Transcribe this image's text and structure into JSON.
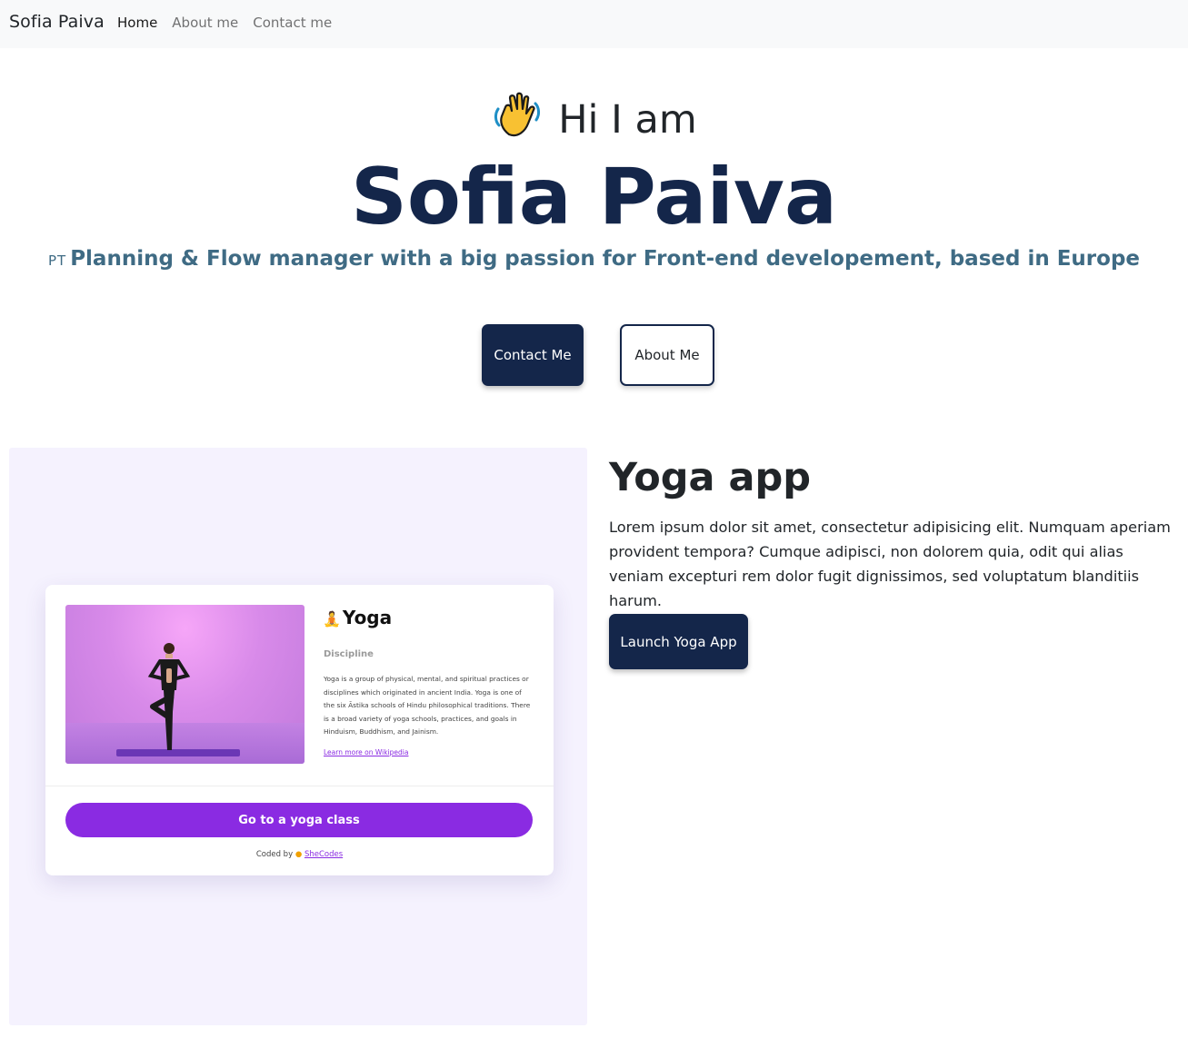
{
  "navbar": {
    "brand": "Sofia Paiva",
    "links": [
      {
        "label": "Home",
        "active": true
      },
      {
        "label": "About me",
        "active": false
      },
      {
        "label": "Contact me",
        "active": false
      }
    ]
  },
  "hero": {
    "greeting_icon": "waving-hand-icon",
    "greeting": "Hi I am",
    "name": "Sofia Paiva",
    "flag": "PT",
    "subtitle": "Planning & Flow manager with a big passion for Front-end developement, based in Europe",
    "contact_button": "Contact Me",
    "about_button": "About Me"
  },
  "project": {
    "title": "Yoga app",
    "description": "Lorem ipsum dolor sit amet, consectetur adipisicing elit. Numquam aperiam provident tempora? Cumque adipisci, non dolorem quia, odit qui alias veniam excepturi rem dolor fugit dignissimos, sed voluptatum blanditiis harum.",
    "launch_button": "Launch Yoga App",
    "preview": {
      "title_icon": "lotus-position-icon",
      "title": "Yoga",
      "subtitle": "Discipline",
      "description": "Yoga is a group of physical, mental, and spiritual practices or disciplines which originated in ancient India. Yoga is one of the six Āstika schools of Hindu philosophical traditions. There is a broad variety of yoga schools, practices, and goals in Hinduism, Buddhism, and Jainism.",
      "link": "Learn more on Wikipedia",
      "button": "Go to a yoga class",
      "coded_by": "Coded by",
      "coded_icon": "shecodes-logo-icon",
      "coded_link": "SheCodes"
    }
  },
  "colors": {
    "navy": "#14264a",
    "teal_text": "#3f6b84",
    "purple": "#8a2be2",
    "preview_bg": "#f5f2fe"
  }
}
